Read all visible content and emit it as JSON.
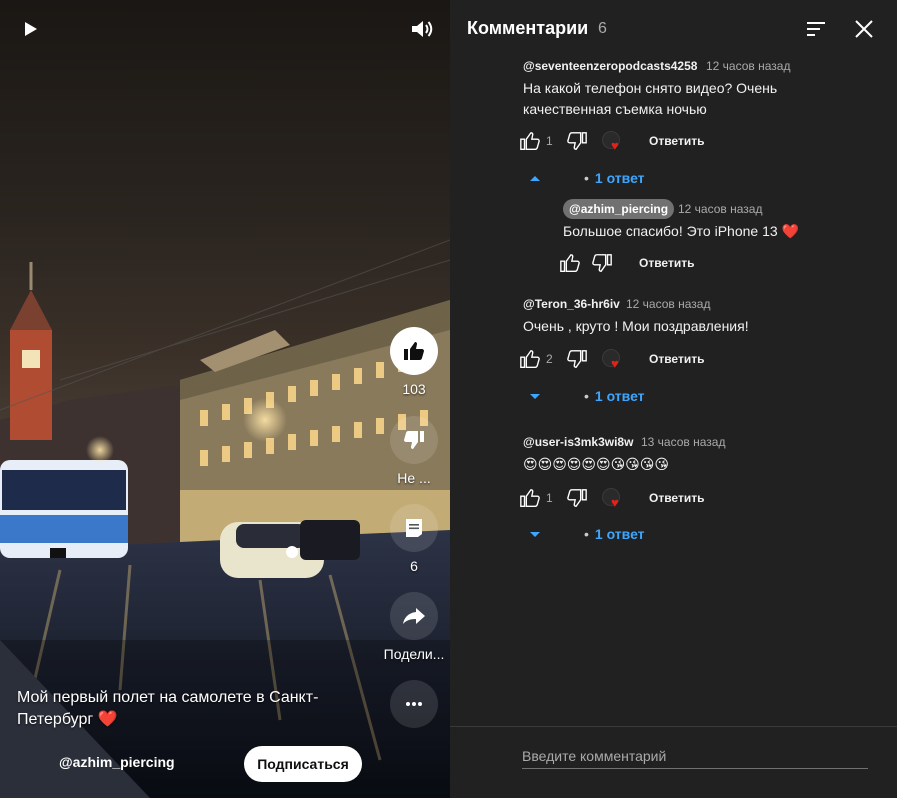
{
  "player": {
    "play_icon": "play-icon",
    "volume_icon": "volume-icon",
    "title": "Мой первый полет на самолете в Санкт-Петербург",
    "title_emoji": "❤️",
    "channel": "@azhim_piercing",
    "subscribe_label": "Подписаться",
    "actions": {
      "like_count": "103",
      "dislike_label": "Не ...",
      "comments_count": "6",
      "share_label": "Подели..."
    }
  },
  "comments_panel": {
    "title": "Комментарии",
    "count": "6",
    "input_placeholder": "Введите комментарий",
    "comments": [
      {
        "author": "@seventeenzeropodcasts4258",
        "time": "12 часов назад",
        "text": "На какой телефон снято видео? Очень качественная съемка ночью",
        "likes": "1",
        "reply_label": "Ответить",
        "replies_toggle": "1 ответ",
        "reply": {
          "author": "@azhim_piercing",
          "time": "12 часов назад",
          "text": "Большое спасибо! Это iPhone 13 ❤️",
          "reply_label": "Ответить"
        }
      },
      {
        "author": "@Teron_36-hr6iv",
        "time": "12 часов назад",
        "text": "Очень , круто ! Мои поздравления!",
        "likes": "2",
        "reply_label": "Ответить",
        "replies_toggle": "1 ответ"
      },
      {
        "author": "@user-is3mk3wi8w",
        "time": "13 часов назад",
        "text": "😍😍😍😍😍😍😘😘😘😘",
        "likes": "1",
        "reply_label": "Ответить",
        "replies_toggle": "1 ответ"
      }
    ]
  }
}
